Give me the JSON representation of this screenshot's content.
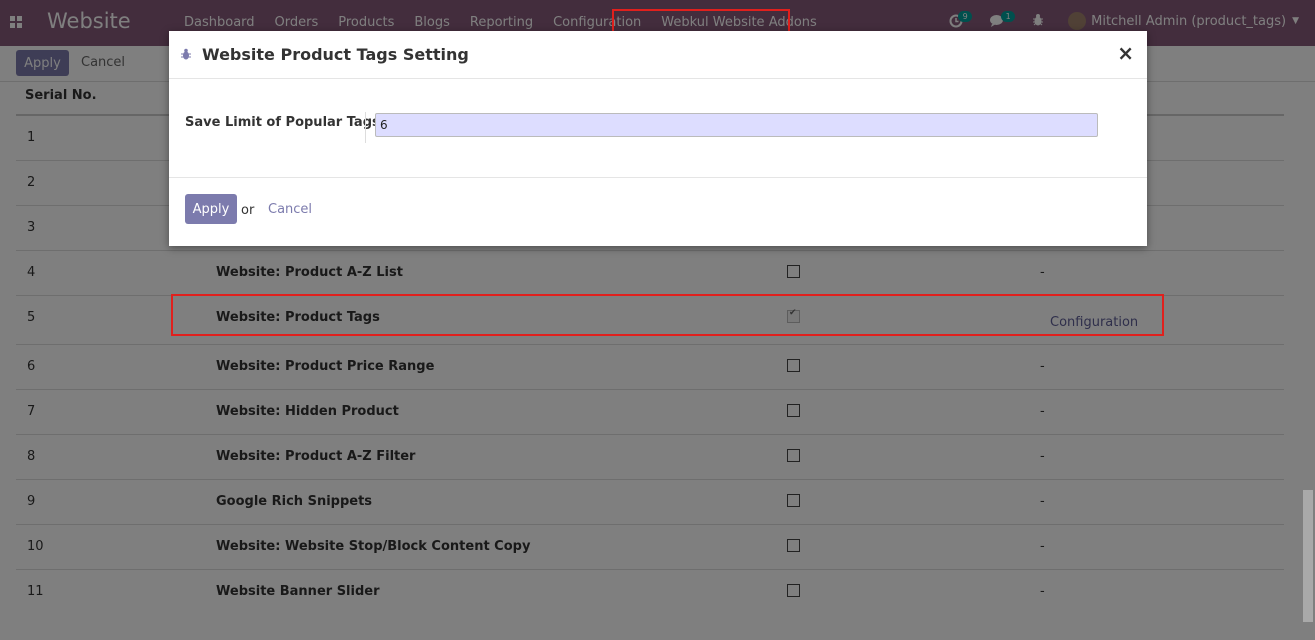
{
  "navbar": {
    "app_title": "Website",
    "menu": [
      "Dashboard",
      "Orders",
      "Products",
      "Blogs",
      "Reporting",
      "Configuration",
      "Webkul Website Addons"
    ],
    "activity_count": "9",
    "message_count": "1",
    "user": "Mitchell Admin (product_tags)"
  },
  "control_panel": {
    "apply_label": "Apply",
    "cancel_label": "Cancel"
  },
  "list": {
    "header_serial": "Serial No.",
    "rows": [
      {
        "sn": "1",
        "name": "",
        "checked": false,
        "cfg": ""
      },
      {
        "sn": "2",
        "name": "",
        "checked": false,
        "cfg": ""
      },
      {
        "sn": "3",
        "name": "",
        "checked": false,
        "cfg": ""
      },
      {
        "sn": "4",
        "name": "Website: Product A-Z List",
        "checked": false,
        "cfg": "-"
      },
      {
        "sn": "5",
        "name": "Website: Product Tags",
        "checked": true,
        "cfg": "Configuration"
      },
      {
        "sn": "6",
        "name": "Website: Product Price Range",
        "checked": false,
        "cfg": "-"
      },
      {
        "sn": "7",
        "name": "Website: Hidden Product",
        "checked": false,
        "cfg": "-"
      },
      {
        "sn": "8",
        "name": "Website: Product A-Z Filter",
        "checked": false,
        "cfg": "-"
      },
      {
        "sn": "9",
        "name": "Google Rich Snippets",
        "checked": false,
        "cfg": "-"
      },
      {
        "sn": "10",
        "name": "Website: Website Stop/Block Content Copy",
        "checked": false,
        "cfg": "-"
      },
      {
        "sn": "11",
        "name": "Website Banner Slider",
        "checked": false,
        "cfg": "-"
      }
    ]
  },
  "modal": {
    "title": "Website Product Tags Setting",
    "field_label": "Save Limit of Popular Tags",
    "field_value": "6",
    "apply_label": "Apply",
    "or_label": "or",
    "cancel_label": "Cancel"
  },
  "colors": {
    "navbar": "#875a7b",
    "primary": "#7c7bad",
    "highlight": "#e0201d"
  }
}
